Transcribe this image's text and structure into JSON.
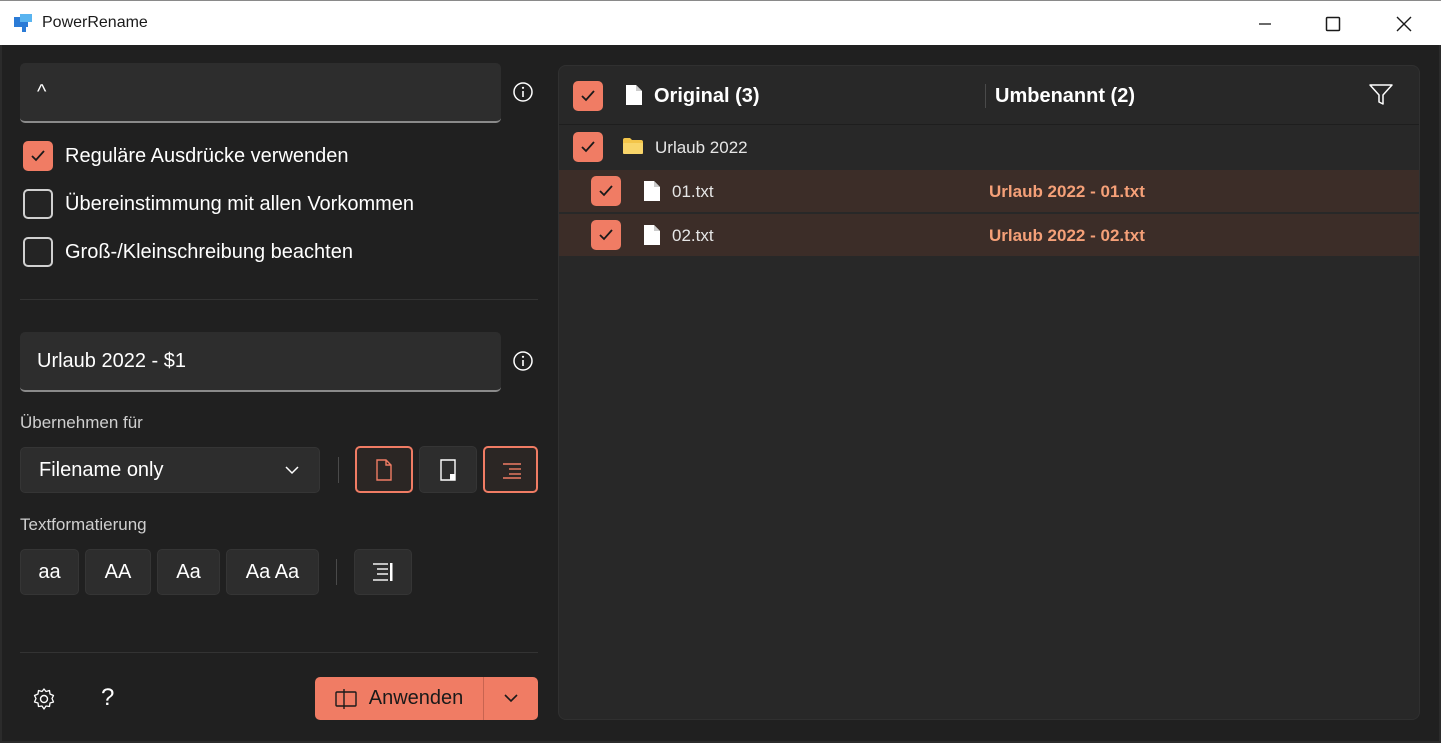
{
  "window": {
    "title": "PowerRename"
  },
  "search": {
    "value": "^"
  },
  "options": [
    {
      "label": "Reguläre Ausdrücke verwenden",
      "checked": true
    },
    {
      "label": "Übereinstimmung mit allen Vorkommen",
      "checked": false
    },
    {
      "label": "Groß-/Kleinschreibung beachten",
      "checked": false
    }
  ],
  "replace": {
    "value": "Urlaub 2022 - $1"
  },
  "apply_for": {
    "label": "Übernehmen für",
    "selected": "Filename only"
  },
  "text_format": {
    "label": "Textformatierung",
    "buttons": [
      "aa",
      "AA",
      "Aa",
      "Aa Aa"
    ]
  },
  "apply_button": {
    "label": "Anwenden"
  },
  "help": {
    "glyph": "?"
  },
  "table": {
    "col_original": "Original (3)",
    "col_renamed": "Umbenannt (2)",
    "rows": [
      {
        "original": "Urlaub 2022",
        "renamed": "",
        "type": "folder",
        "checked": true
      },
      {
        "original": "01.txt",
        "renamed": "Urlaub 2022 - 01.txt",
        "type": "file",
        "checked": true
      },
      {
        "original": "02.txt",
        "renamed": "Urlaub 2022 - 02.txt",
        "type": "file",
        "checked": true
      }
    ]
  },
  "colors": {
    "accent": "#f07c64",
    "renamed_text": "#f5a078",
    "highlight_row": "#3c2d28"
  }
}
